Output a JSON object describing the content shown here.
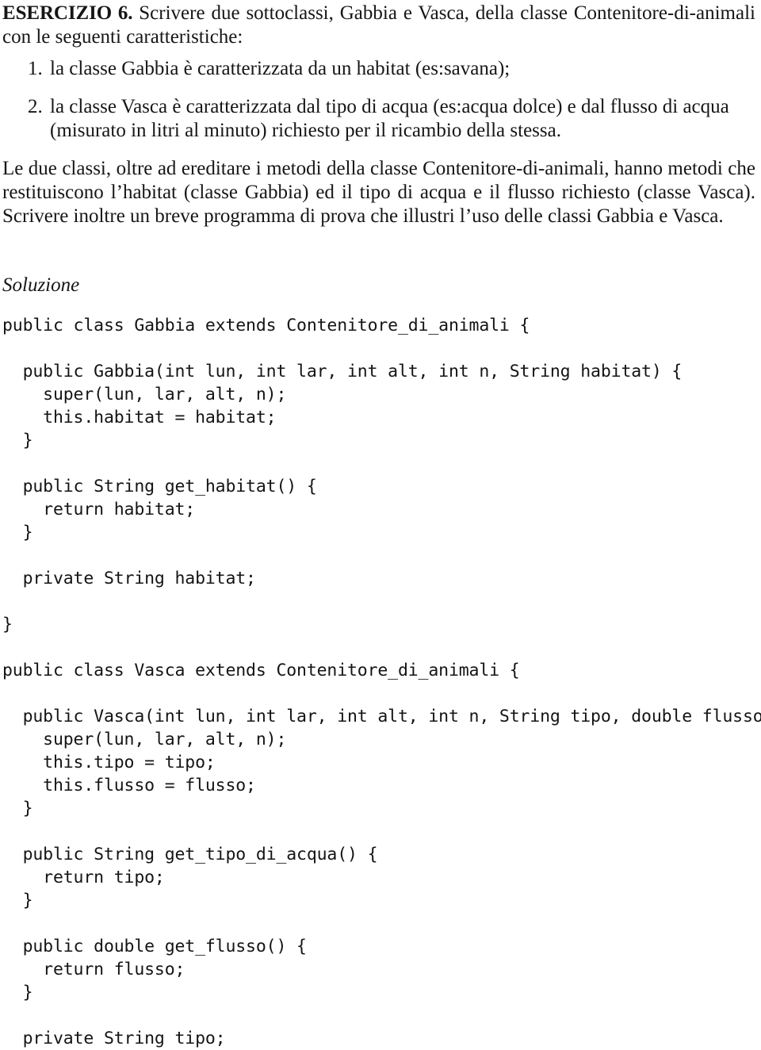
{
  "document": {
    "type": "exercise-solution-page",
    "language": "it",
    "background_color": "#ffffff",
    "text_color": "#161616"
  },
  "exercise": {
    "label": "ESERCIZIO 6.",
    "statement": " Scrivere due sottoclassi, Gabbia e Vasca, della classe Contenitore‐di‐animali con le seguenti caratteristiche:",
    "requirements": [
      {
        "number": "1.",
        "text": "la classe Gabbia è caratterizzata da un habitat (es:savana);"
      },
      {
        "number": "2.",
        "text": "la classe Vasca è caratterizzata dal tipo di acqua (es:acqua dolce) e dal flusso di acqua",
        "text_continued": "(misurato in litri al minuto) richiesto per il ricambio della stessa."
      }
    ],
    "description": "Le due classi, oltre ad ereditare i metodi della classe Contenitore‐di‐animali, hanno metodi che restituiscono l’habitat (classe Gabbia) ed il tipo di acqua e il flusso richiesto (classe Vasca). Scrivere inoltre un breve programma di prova che illustri l’uso delle classi Gabbia e Vasca."
  },
  "solution": {
    "heading": "Soluzione",
    "code_lines": [
      "public class Gabbia extends Contenitore_di_animali {",
      "",
      "  public Gabbia(int lun, int lar, int alt, int n, String habitat) {",
      "    super(lun, lar, alt, n);",
      "    this.habitat = habitat;",
      "  }",
      "",
      "  public String get_habitat() {",
      "    return habitat;",
      "  }",
      "",
      "  private String habitat;",
      "",
      "}",
      "",
      "public class Vasca extends Contenitore_di_animali {",
      "",
      "  public Vasca(int lun, int lar, int alt, int n, String tipo, double flusso) {",
      "    super(lun, lar, alt, n);",
      "    this.tipo = tipo;",
      "    this.flusso = flusso;",
      "  }",
      "",
      "  public String get_tipo_di_acqua() {",
      "    return tipo;",
      "  }",
      "",
      "  public double get_flusso() {",
      "    return flusso;",
      "  }",
      "",
      "  private String tipo;"
    ]
  }
}
